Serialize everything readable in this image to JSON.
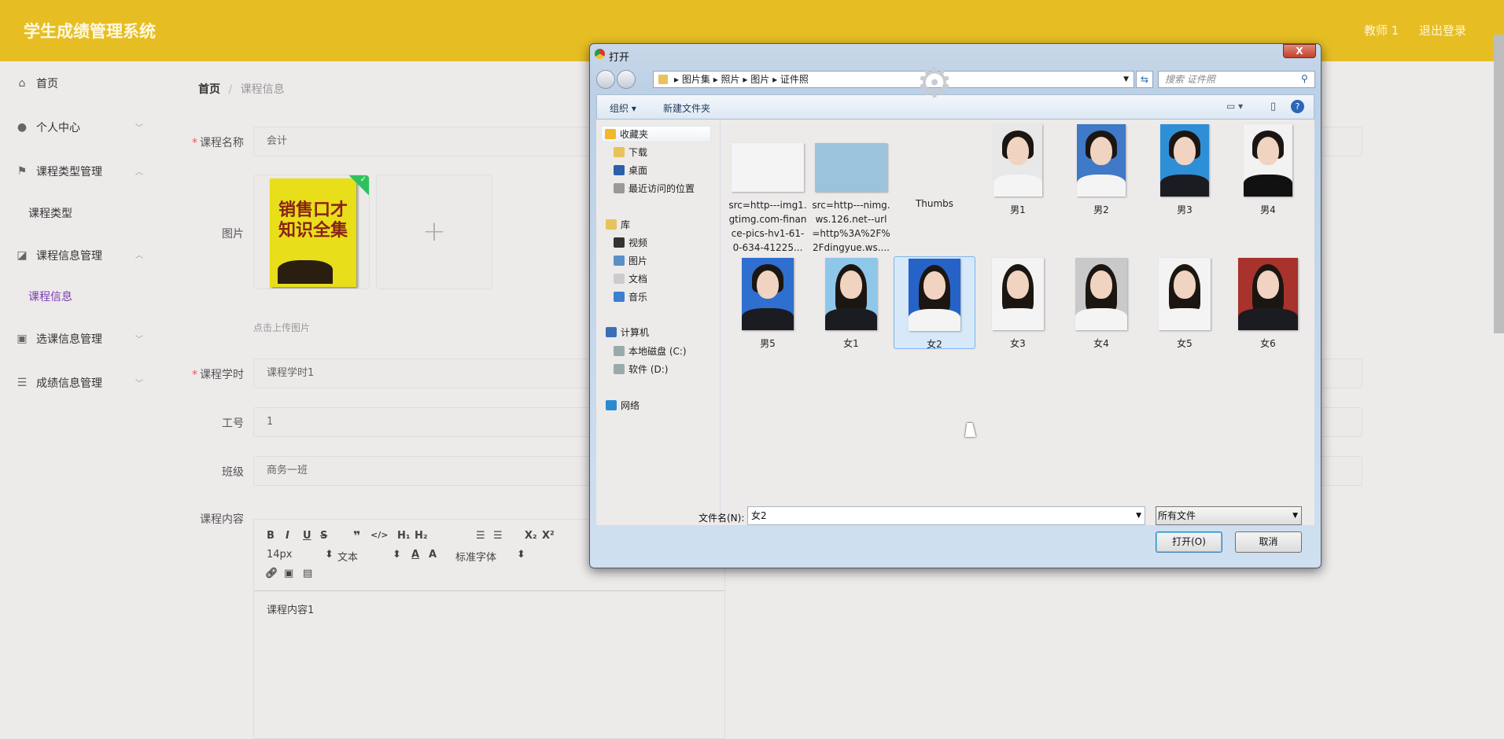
{
  "header": {
    "title": "学生成绩管理系统",
    "user": "教师 1",
    "logout": "退出登录",
    "bg_color": "#e6be24"
  },
  "sidebar": {
    "items": [
      {
        "label": "首页",
        "icon": "home-icon"
      },
      {
        "label": "个人中心",
        "icon": "user-icon"
      },
      {
        "label": "课程类型管理",
        "icon": "flag-icon",
        "sub": "课程类型"
      },
      {
        "label": "课程信息管理",
        "icon": "chart-icon",
        "sub": "课程信息"
      },
      {
        "label": "选课信息管理",
        "icon": "clipboard-icon"
      },
      {
        "label": "成绩信息管理",
        "icon": "list-icon"
      }
    ],
    "active_color": "#7b3fb0"
  },
  "breadcrumb": {
    "home": "首页",
    "sep": "/",
    "current": "课程信息"
  },
  "form": {
    "name_label": "课程名称",
    "name_value": "会计",
    "image_label": "图片",
    "upload_hint": "点击上传图片",
    "image_text": "销售口才知识全集",
    "hours_label": "课程学时",
    "hours_value": "课程学时1",
    "id_label": "工号",
    "id_value": "1",
    "class_label": "班级",
    "class_value": "商务一班",
    "content_label": "课程内容",
    "content_value": "课程内容1",
    "editor": {
      "font_size": "14px",
      "block": "文本",
      "font": "标准字体"
    }
  },
  "dialog": {
    "title": "打开",
    "close": "X",
    "path": [
      "图片集",
      "照片",
      "图片",
      "证件照"
    ],
    "search_placeholder": "搜索 证件照",
    "organize": "组织 ▾",
    "new_folder": "新建文件夹",
    "nav": [
      {
        "label": "收藏夹",
        "icon": "star-icon"
      },
      {
        "label": "下载",
        "icon": "download-folder-icon"
      },
      {
        "label": "桌面",
        "icon": "desktop-icon"
      },
      {
        "label": "最近访问的位置",
        "icon": "recent-icon"
      },
      {
        "label": "库",
        "icon": "library-icon"
      },
      {
        "label": "视频",
        "icon": "video-icon"
      },
      {
        "label": "图片",
        "icon": "pictures-icon"
      },
      {
        "label": "文档",
        "icon": "documents-icon"
      },
      {
        "label": "音乐",
        "icon": "music-icon"
      },
      {
        "label": "计算机",
        "icon": "computer-icon"
      },
      {
        "label": "本地磁盘 (C:)",
        "icon": "disk-icon"
      },
      {
        "label": "软件 (D:)",
        "icon": "disk-icon"
      },
      {
        "label": "网络",
        "icon": "network-icon"
      }
    ],
    "files": [
      {
        "name": "src=http---img1.gtimg.com-finance-pics-hv1-61-0-634-41225...",
        "bg": "#f4f4f4"
      },
      {
        "name": "src=http---nimg.ws.126.net--url=http%3A%2F%2Fdingyue.ws....",
        "bg": "#9cc3dc"
      },
      {
        "name": "Thumbs",
        "bg": "#edeaea"
      },
      {
        "name": "男1",
        "bg": "#e8e8e8"
      },
      {
        "name": "男2",
        "bg": "#3f79c8"
      },
      {
        "name": "男3",
        "bg": "#2f8fd6"
      },
      {
        "name": "男4",
        "bg": "#f2f2f2"
      },
      {
        "name": "男5",
        "bg": "#2f6fcf"
      },
      {
        "name": "女1",
        "bg": "#8fc7ea"
      },
      {
        "name": "女2",
        "bg": "#2663c9"
      },
      {
        "name": "女3",
        "bg": "#f3f3f3"
      },
      {
        "name": "女4",
        "bg": "#c9c9c9"
      },
      {
        "name": "女5",
        "bg": "#f3f3f3"
      },
      {
        "name": "女6",
        "bg": "#a8322c"
      }
    ],
    "selected": "女2",
    "filename_label": "文件名(N):",
    "filename_value": "女2",
    "filetype": "所有文件",
    "open": "打开(O)",
    "cancel": "取消"
  }
}
